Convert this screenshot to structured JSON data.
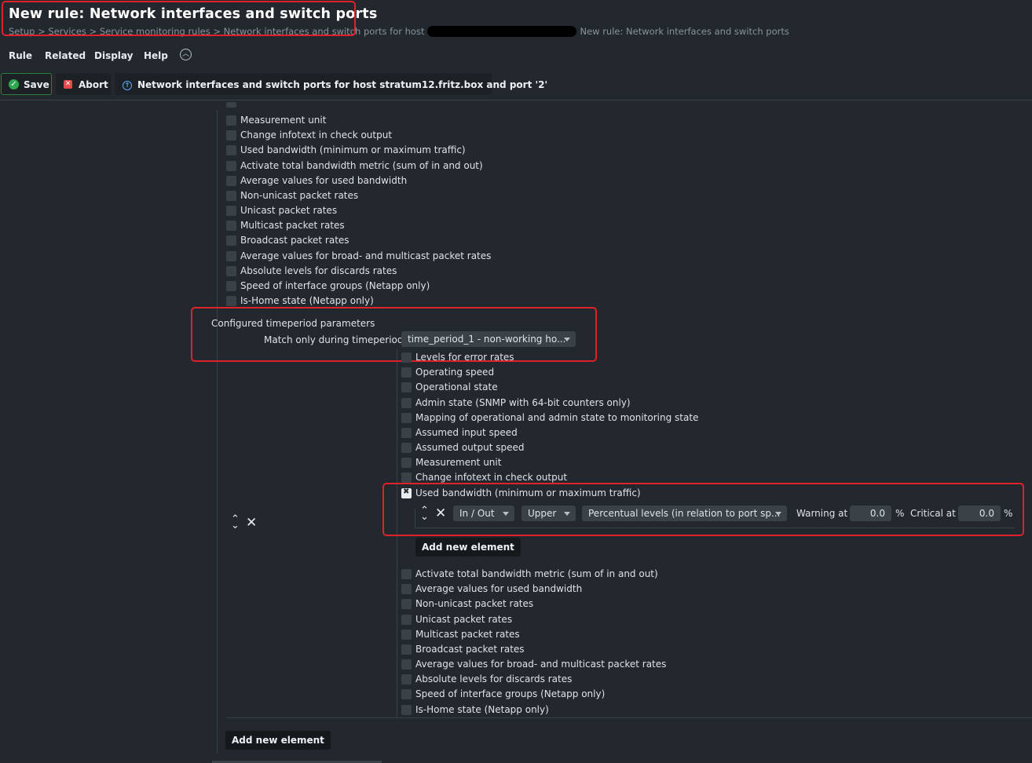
{
  "page": {
    "title": "New rule: Network interfaces and switch ports",
    "breadcrumb_left": "Setup > Services > Service monitoring rules > Network interfaces and switch ports for host",
    "breadcrumb_right": "New rule: Network interfaces and switch ports"
  },
  "menu": {
    "rule": "Rule",
    "related": "Related",
    "display": "Display",
    "help": "Help",
    "collapse_icon": "chevron-up-circle"
  },
  "toolbar": {
    "save": "Save",
    "abort": "Abort",
    "context": "Network interfaces and switch ports for host stratum12.fritz.box and port '2'"
  },
  "outer_options": [
    "Measurement unit",
    "Change infotext in check output",
    "Used bandwidth (minimum or maximum traffic)",
    "Activate total bandwidth metric (sum of in and out)",
    "Average values for used bandwidth",
    "Non-unicast packet rates",
    "Unicast packet rates",
    "Multicast packet rates",
    "Broadcast packet rates",
    "Average values for broad- and multicast packet rates",
    "Absolute levels for discards rates",
    "Speed of interface groups (Netapp only)",
    "Is-Home state (Netapp only)"
  ],
  "timeperiod": {
    "section_label": "Configured timeperiod parameters",
    "match_label": "Match only during timeperiod",
    "match_value": "time_period_1 - non-working ho..."
  },
  "inner_options_top": [
    "Levels for error rates",
    "Operating speed",
    "Operational state",
    "Admin state (SNMP with 64-bit counters only)",
    "Mapping of operational and admin state to monitoring state",
    "Assumed input speed",
    "Assumed output speed",
    "Measurement unit",
    "Change infotext in check output"
  ],
  "bandwidth": {
    "label": "Used bandwidth (minimum or maximum traffic)",
    "checked": true,
    "direction": "In / Out",
    "bound": "Upper",
    "levels_type": "Percentual levels (in relation to port sp...",
    "warning_label": "Warning at",
    "warning_value": "0.0",
    "warning_unit": "%",
    "critical_label": "Critical at",
    "critical_value": "0.0",
    "critical_unit": "%",
    "add_label": "Add new element"
  },
  "inner_options_bottom": [
    "Activate total bandwidth metric (sum of in and out)",
    "Average values for used bandwidth",
    "Non-unicast packet rates",
    "Unicast packet rates",
    "Multicast packet rates",
    "Broadcast packet rates",
    "Average values for broad- and multicast packet rates",
    "Absolute levels for discards rates",
    "Speed of interface groups (Netapp only)",
    "Is-Home state (Netapp only)"
  ],
  "outer_add_label": "Add new element",
  "colors": {
    "background": "#22282d",
    "checkbox": "#3a4248",
    "highlight_red": "#e0202a",
    "save_green": "#2ea851"
  }
}
